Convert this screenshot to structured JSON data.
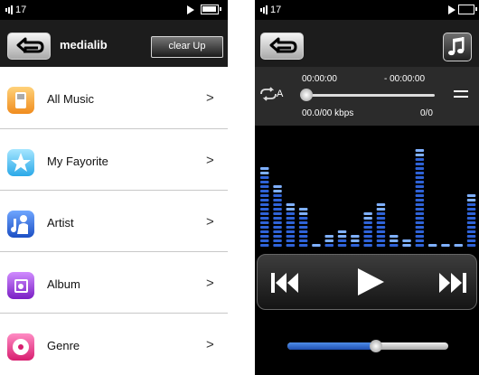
{
  "library": {
    "status": {
      "signal_text": "17"
    },
    "header": {
      "title": "medialib",
      "clear_button": "clear Up"
    },
    "items": [
      {
        "label": "All Music",
        "arrow": ">",
        "icon": "ipod-icon",
        "color": "#f0a830"
      },
      {
        "label": "My Fayorite",
        "arrow": ">",
        "icon": "star-icon",
        "color": "#45bdf0"
      },
      {
        "label": "Artist",
        "arrow": ">",
        "icon": "artist-icon",
        "color": "#2f6fe0"
      },
      {
        "label": "Album",
        "arrow": ">",
        "icon": "album-icon",
        "color": "#9a35d8"
      },
      {
        "label": "Genre",
        "arrow": ">",
        "icon": "genre-icon",
        "color": "#e63c93"
      }
    ]
  },
  "player": {
    "status": {
      "signal_text": "17"
    },
    "elapsed": "00:00:00",
    "remaining": "- 00:00:00",
    "bitrate": "00.0/00 kbps",
    "track_count": "0/0",
    "repeat_mode": "A",
    "progress": 0,
    "volume": 0.55,
    "equalizer_levels": [
      0.7,
      0.55,
      0.4,
      0.35,
      0.02,
      0.1,
      0.15,
      0.12,
      0.3,
      0.4,
      0.12,
      0.06,
      0.85,
      0.05,
      0.05,
      0.05,
      0.45
    ]
  },
  "colors": {
    "accent": "#2f63d8",
    "eq_top": "#7fb0ff"
  }
}
